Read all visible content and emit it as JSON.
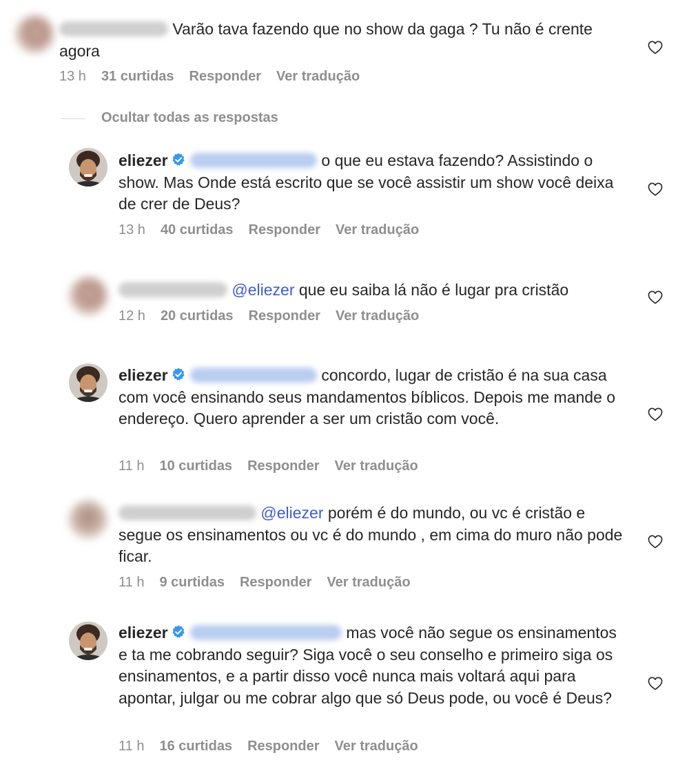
{
  "comments": [
    {
      "text": "Varão tava fazendo que no show da gaga ? Tu não é crente agora",
      "time": "13 h",
      "likes": "31 curtidas",
      "reply": "Responder",
      "translate": "Ver tradução"
    },
    {
      "user": "eliezer",
      "text": "o que eu estava fazendo? Assistindo o show. Mas Onde está escrito que se você assistir um show você deixa de crer de Deus?",
      "time": "13 h",
      "likes": "40 curtidas",
      "reply": "Responder",
      "translate": "Ver tradução"
    },
    {
      "mention": "@eliezer",
      "text": "que eu saiba lá não é lugar pra cristão",
      "time": "12 h",
      "likes": "20 curtidas",
      "reply": "Responder",
      "translate": "Ver tradução"
    },
    {
      "user": "eliezer",
      "text": "concordo, lugar de cristão é na sua casa com você ensinando seus mandamentos bíblicos. Depois me mande o endereço. Quero aprender a ser um cristão com você.",
      "time": "11 h",
      "likes": "10 curtidas",
      "reply": "Responder",
      "translate": "Ver tradução"
    },
    {
      "mention": "@eliezer",
      "text": "porém é do mundo, ou vc é cristão e segue os ensinamentos ou vc é do mundo , em cima do muro não pode ficar.",
      "time": "11 h",
      "likes": "9 curtidas",
      "reply": "Responder",
      "translate": "Ver tradução"
    },
    {
      "user": "eliezer",
      "text": "mas você não segue os ensinamentos e ta me cobrando seguir? Siga você o seu conselho e primeiro siga os ensinamentos, e a partir disso você nunca mais voltará aqui para apontar, julgar ou me cobrar algo que só Deus pode, ou você é Deus?",
      "time": "11 h",
      "likes": "16 curtidas",
      "reply": "Responder",
      "translate": "Ver tradução"
    }
  ],
  "hide_replies": "Ocultar todas as respostas",
  "colors": {
    "mention": "#3f5bd3",
    "meta": "#8e8e8e",
    "verified": "#3897f0"
  },
  "icons": {
    "like": "heart-outline-icon",
    "verified": "verified-badge-icon"
  }
}
